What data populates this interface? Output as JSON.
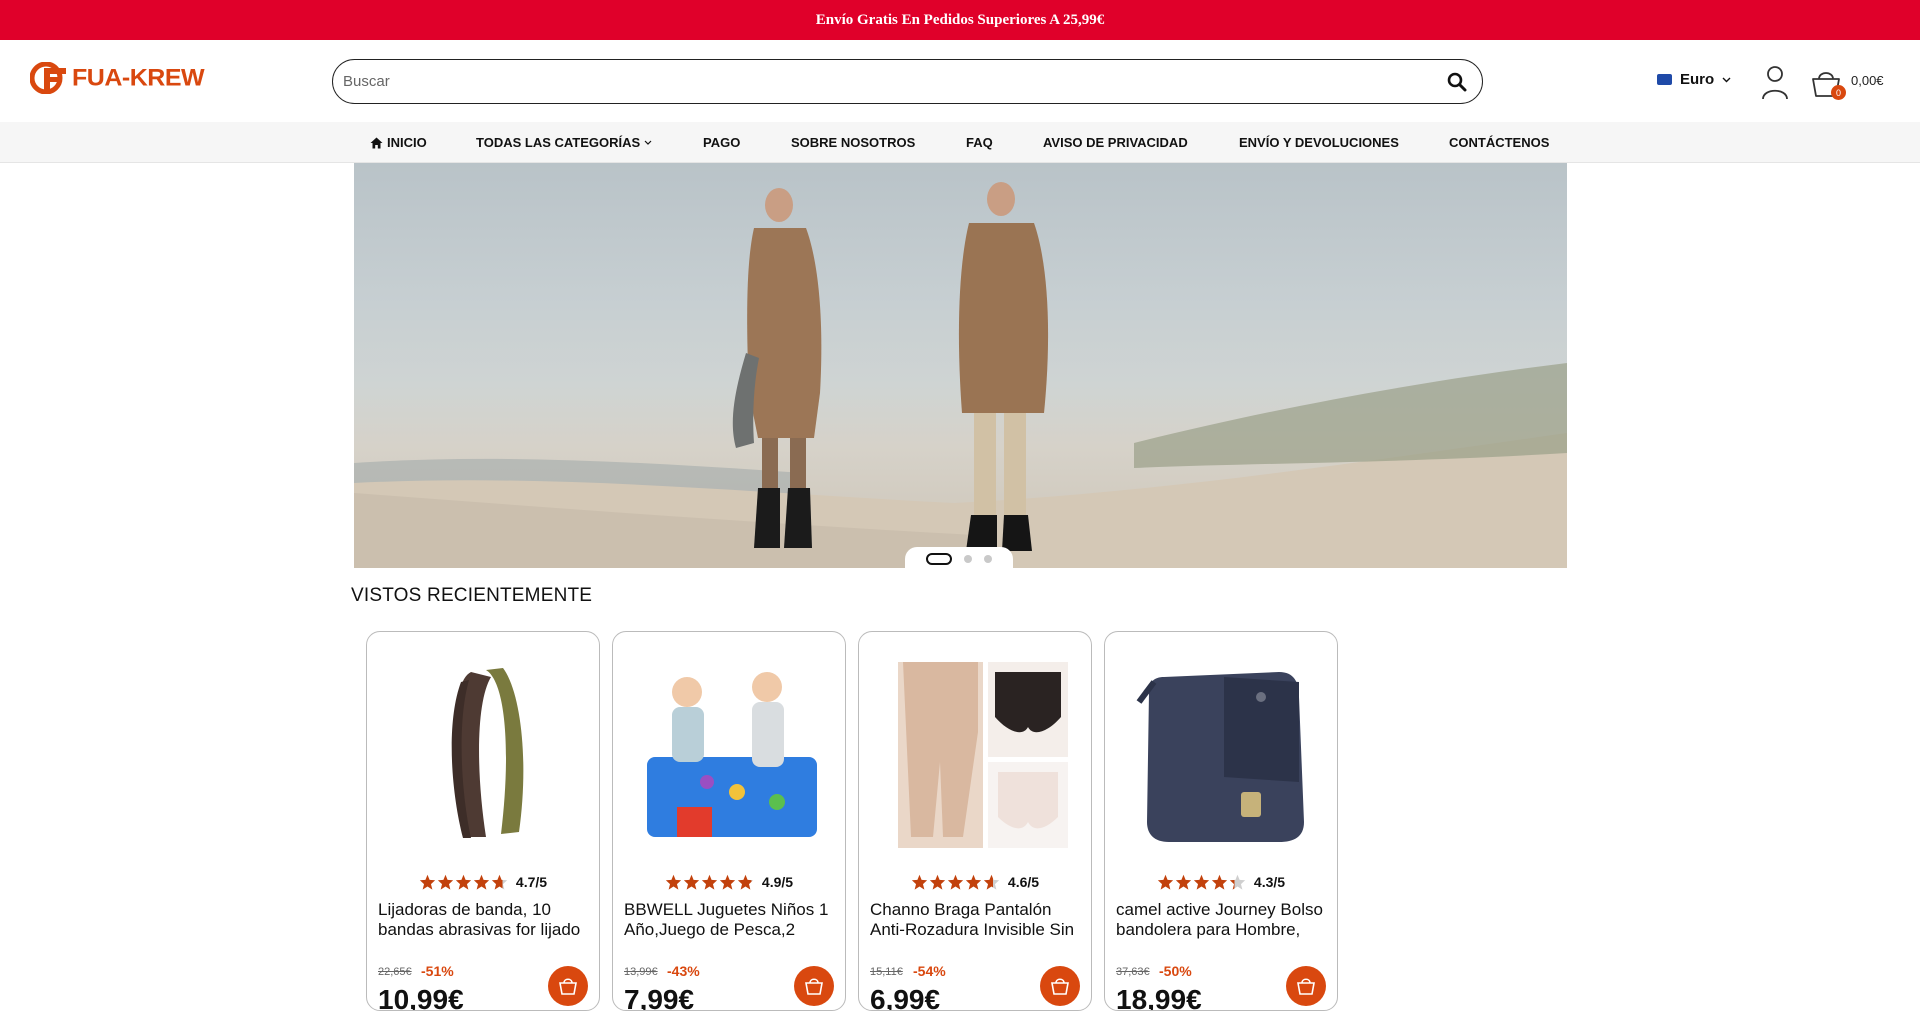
{
  "announcement": "Envío Gratis En Pedidos Superiores A 25,99€",
  "logo": {
    "text": "FUA-KREW",
    "color": "#d9480f"
  },
  "search": {
    "placeholder": "Buscar",
    "value": ""
  },
  "currency": {
    "label": "Euro"
  },
  "cart": {
    "count": "0",
    "total": "0,00€"
  },
  "nav": [
    {
      "label": "INICIO",
      "icon": "home-icon"
    },
    {
      "label": "TODAS LAS CATEGORÍAS",
      "icon": "chevron-down-icon"
    },
    {
      "label": "PAGO"
    },
    {
      "label": "SOBRE NOSOTROS"
    },
    {
      "label": "FAQ"
    },
    {
      "label": "AVISO DE PRIVACIDAD"
    },
    {
      "label": "ENVÍO Y DEVOLUCIONES"
    },
    {
      "label": "CONTÁCTENOS"
    }
  ],
  "slider": {
    "slides": 3,
    "active": 1
  },
  "recent": {
    "title": "VISTOS RECIENTEMENTE",
    "products": [
      {
        "title": "Lijadoras de banda, 10 bandas abrasivas for lijado",
        "rating": "4.7/5",
        "stars": 4.7,
        "old_price": "22,65€",
        "discount": "-51%",
        "price": "10,99€"
      },
      {
        "title": "BBWELL Juguetes Niños 1 Año,Juego de Pesca,2",
        "rating": "4.9/5",
        "stars": 4.9,
        "old_price": "13,99€",
        "discount": "-43%",
        "price": "7,99€"
      },
      {
        "title": "Channo Braga Pantalón Anti-Rozadura Invisible Sin",
        "rating": "4.6/5",
        "stars": 4.6,
        "old_price": "15,11€",
        "discount": "-54%",
        "price": "6,99€"
      },
      {
        "title": "camel active Journey Bolso bandolera para Hombre,",
        "rating": "4.3/5",
        "stars": 4.3,
        "old_price": "37,63€",
        "discount": "-50%",
        "price": "18,99€"
      }
    ]
  },
  "colors": {
    "accent": "#d9480f",
    "topbar": "#e0002a",
    "star": "#c2410c"
  }
}
